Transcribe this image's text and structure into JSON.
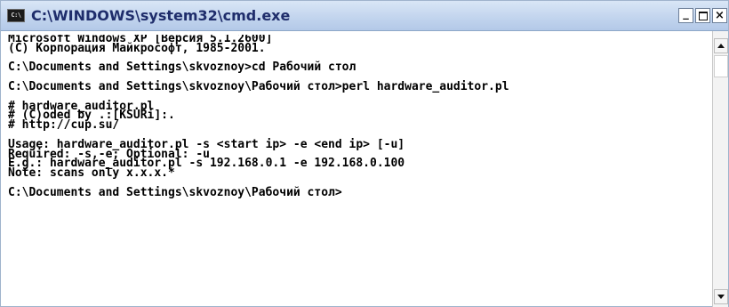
{
  "window": {
    "title": "C:\\WINDOWS\\system32\\cmd.exe",
    "icon_label": "C:\\",
    "icon": "cmd-console-icon",
    "buttons": {
      "minimize": "_",
      "close": "×"
    }
  },
  "console": {
    "lines": [
      "Microsoft Windows XP [Версия 5.1.2600]",
      "(С) Корпорация Майкрософт, 1985-2001.",
      "",
      "C:\\Documents and Settings\\skvoznoy>cd Рабочий стол",
      "",
      "C:\\Documents and Settings\\skvoznoy\\Рабочий стол>perl hardware_auditor.pl",
      "",
      "# hardware_auditor.pl",
      "# (C)oded by .:[KSURi]:.",
      "# http://cup.su/",
      "",
      "Usage: hardware_auditor.pl -s <start ip> -e <end ip> [-u]",
      "Required: -s,-e; Optional: -u",
      "E.g.: hardware_auditor.pl -s 192.168.0.1 -e 192.168.0.100",
      "Note: scans only x.x.x.*",
      "",
      "C:\\Documents and Settings\\skvoznoy\\Рабочий стол>"
    ]
  },
  "colors": {
    "titlebar": "#c3d5ee",
    "title_text": "#1f2d6b",
    "console_bg": "#ffffff",
    "console_text": "#000000"
  }
}
